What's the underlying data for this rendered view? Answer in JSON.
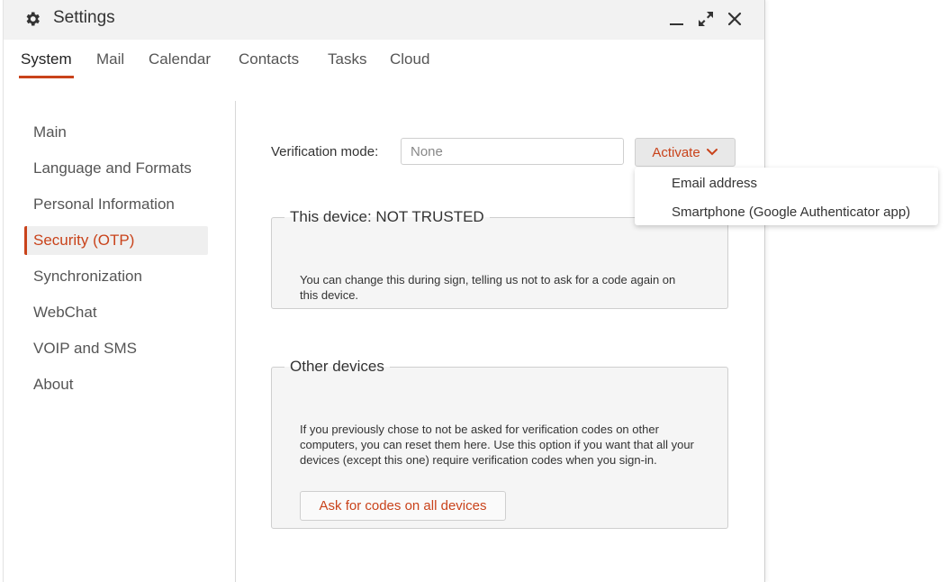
{
  "window": {
    "title": "Settings",
    "icon": "gear-icon"
  },
  "tabs": [
    {
      "label": "System",
      "active": true
    },
    {
      "label": "Mail"
    },
    {
      "label": "Calendar"
    },
    {
      "label": "Contacts"
    },
    {
      "label": "Tasks"
    },
    {
      "label": "Cloud"
    }
  ],
  "sidebar": {
    "items": [
      {
        "label": "Main"
      },
      {
        "label": "Language and Formats"
      },
      {
        "label": "Personal Information"
      },
      {
        "label": "Security (OTP)",
        "active": true
      },
      {
        "label": "Synchronization"
      },
      {
        "label": "WebChat"
      },
      {
        "label": "VOIP and SMS"
      },
      {
        "label": "About"
      }
    ]
  },
  "verification": {
    "label": "Verification mode:",
    "placeholder": "None",
    "activate_label": "Activate",
    "menu": [
      {
        "label": "Email address"
      },
      {
        "label": "Smartphone (Google Authenticator app)"
      }
    ]
  },
  "this_device": {
    "legend": "This device: NOT TRUSTED",
    "text": "You can change this during sign, telling us not to ask for a code again on this device."
  },
  "other_devices": {
    "legend": "Other devices",
    "text": "If you previously chose to not be asked for verification codes on other computers, you can reset them here. Use this option if you want that all your devices (except this one) require verification codes when you sign-in.",
    "button_label": "Ask for codes on all devices"
  },
  "colors": {
    "accent": "#c9431b",
    "titlebar_bg": "#f2f2f2",
    "panel_bg": "#f5f5f5"
  }
}
